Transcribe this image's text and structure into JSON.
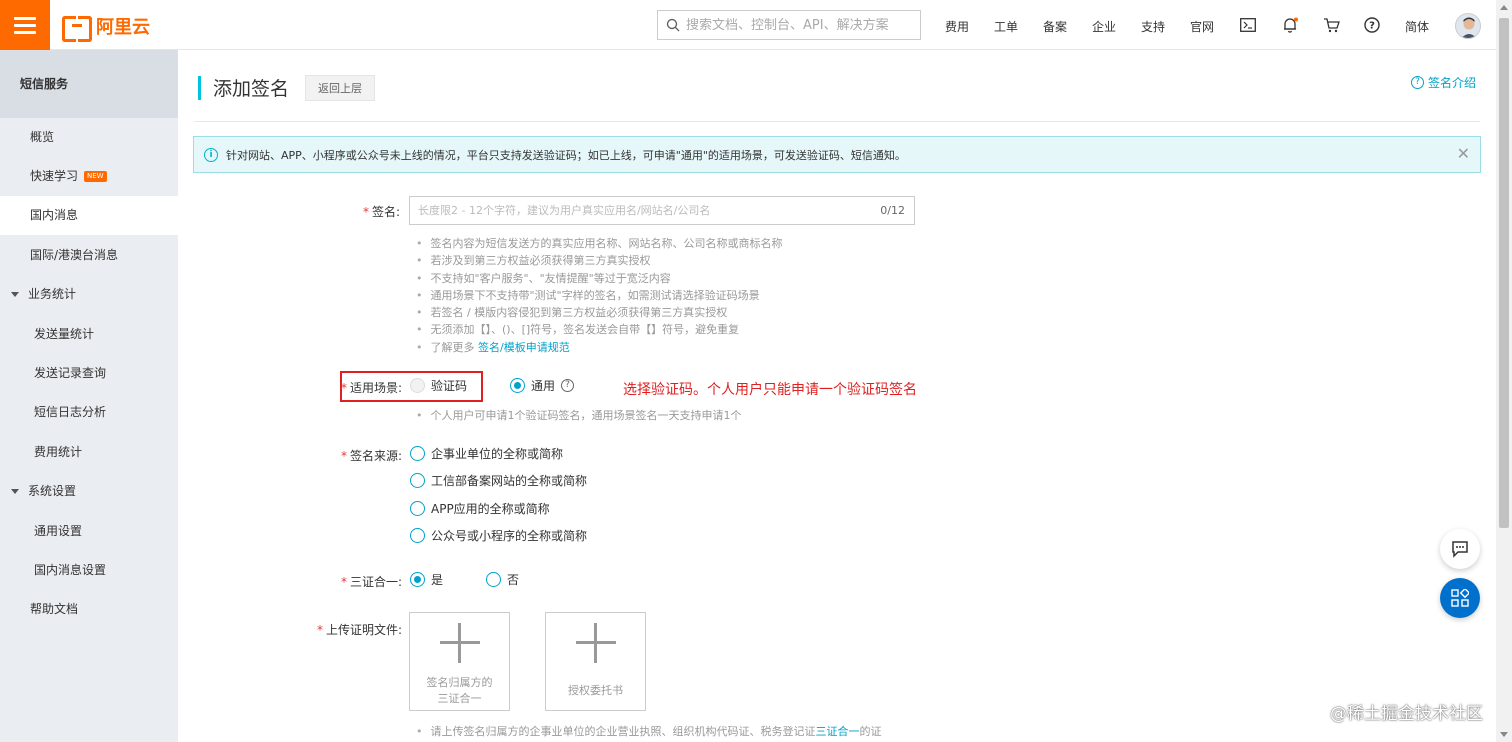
{
  "header": {
    "logo_text": "阿里云",
    "search_placeholder": "搜索文档、控制台、API、解决方案",
    "nav": [
      "费用",
      "工单",
      "备案",
      "企业",
      "支持",
      "官网"
    ],
    "lang": "简体",
    "brand_color": "#ff6a00"
  },
  "sidebar": {
    "title": "短信服务",
    "items": [
      {
        "label": "概览"
      },
      {
        "label": "快速学习",
        "badge": "NEW"
      },
      {
        "label": "国内消息"
      },
      {
        "label": "国际/港澳台消息"
      },
      {
        "label": "业务统计"
      },
      {
        "label": "发送量统计"
      },
      {
        "label": "发送记录查询"
      },
      {
        "label": "短信日志分析"
      },
      {
        "label": "费用统计"
      },
      {
        "label": "系统设置"
      },
      {
        "label": "通用设置"
      },
      {
        "label": "国内消息设置"
      },
      {
        "label": "帮助文档"
      }
    ],
    "active_item": "国内消息"
  },
  "page": {
    "title": "添加签名",
    "back_label": "返回上层",
    "intro_link": "签名介绍",
    "notice": "针对网站、APP、小程序或公众号未上线的情况，平台只支持发送验证码；如已上线，可申请\"通用\"的适用场景，可发送验证码、短信通知。"
  },
  "form": {
    "signature": {
      "label": "签名:",
      "placeholder": "长度限2 - 12个字符，建议为用户真实应用名/网站名/公司名",
      "counter": "0/12",
      "hints": [
        "签名内容为短信发送方的真实应用名称、网站名称、公司名称或商标名称",
        "若涉及到第三方权益必须获得第三方真实授权",
        "不支持如\"客户服务\"、\"友情提醒\"等过于宽泛内容",
        "通用场景下不支持带\"测试\"字样的签名，如需测试请选择验证码场景",
        "若签名 / 模版内容侵犯到第三方权益必须获得第三方真实授权",
        "无须添加【】、()、[]符号，签名发送会自带【】符号，避免重复",
        "了解更多"
      ],
      "more_link": "签名/模板申请规范"
    },
    "scenario": {
      "label": "适用场景:",
      "options": [
        "验证码",
        "通用"
      ],
      "selected": "通用",
      "hint": "个人用户可申请1个验证码签名，通用场景签名一天支持申请1个"
    },
    "annotation": "选择验证码。个人用户只能申请一个验证码签名",
    "source": {
      "label": "签名来源:",
      "options": [
        "企事业单位的全称或简称",
        "工信部备案网站的全称或简称",
        "APP应用的全称或简称",
        "公众号或小程序的全称或简称"
      ]
    },
    "three_in_one": {
      "label": "三证合一:",
      "options": [
        "是",
        "否"
      ],
      "selected": "是"
    },
    "upload": {
      "label": "上传证明文件:",
      "boxes": [
        {
          "line1": "签名归属方的",
          "line2": "三证合一"
        },
        {
          "line1": "授权委托书",
          "line2": ""
        }
      ],
      "hint": "请上传签名归属方的企事业单位的企业营业执照、组织机构代码证、税务登记证",
      "hint_link": "三证合一",
      "hint_tail": "的证"
    }
  },
  "watermark": "@稀土掘金技术社区"
}
